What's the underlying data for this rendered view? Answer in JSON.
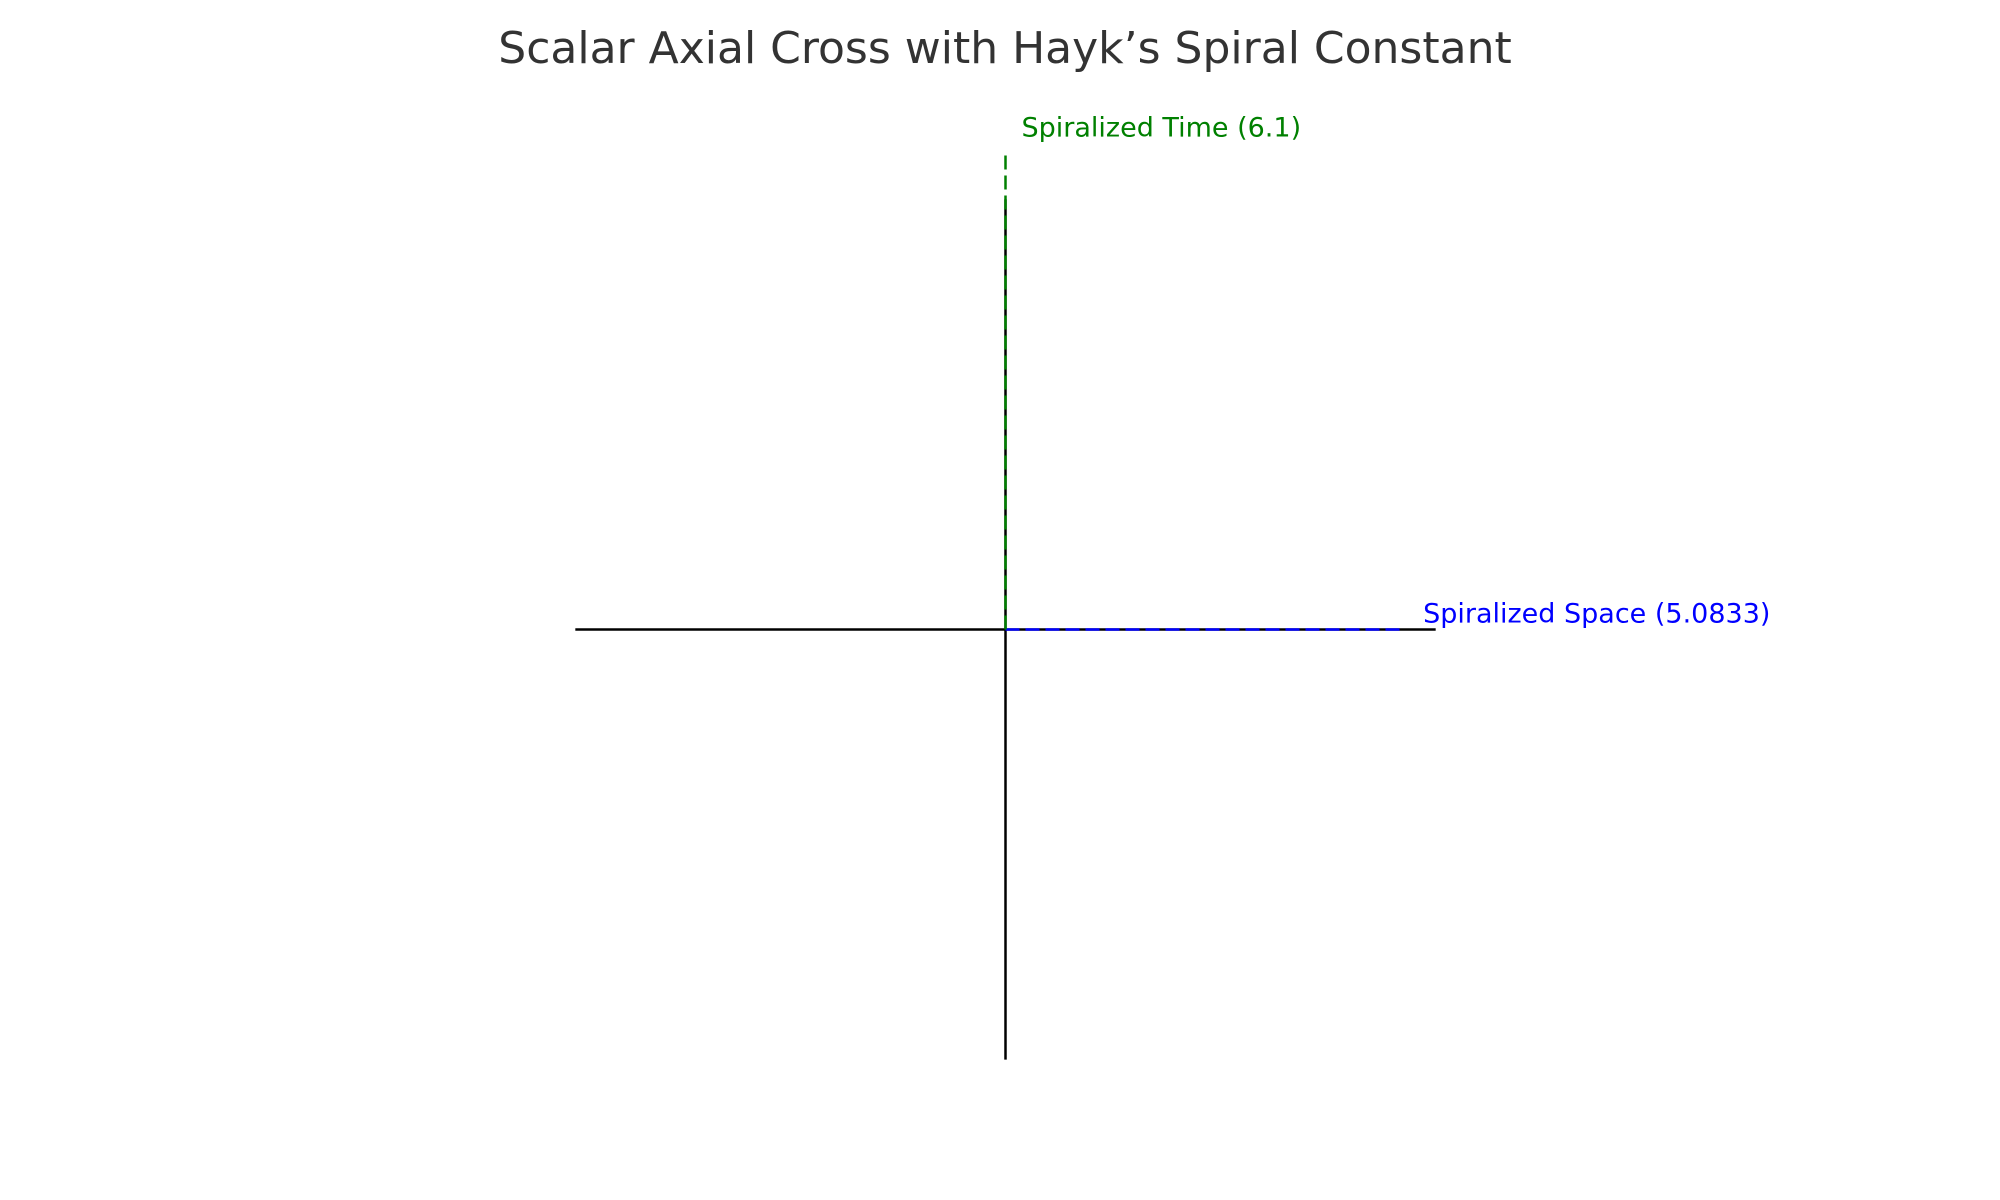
{
  "chart_data": {
    "type": "line",
    "title": "Scalar Axial Cross with Hayk’s Spiral Constant",
    "xlabel": "",
    "ylabel": "",
    "xlim": [
      -7,
      7
    ],
    "ylim": [
      -7,
      7
    ],
    "grid": false,
    "axes_visible": false,
    "axis_line_color": "#000000",
    "series": [
      {
        "name": "Spiralized Space (5.0833)",
        "color": "#0000ff",
        "linestyle": "dashed",
        "x": [
          0,
          5.0833
        ],
        "y": [
          0,
          0
        ]
      },
      {
        "name": "Spiralized Time (6.1)",
        "color": "#008000",
        "linestyle": "dashed",
        "x": [
          0,
          0
        ],
        "y": [
          0,
          6.1
        ]
      }
    ]
  }
}
